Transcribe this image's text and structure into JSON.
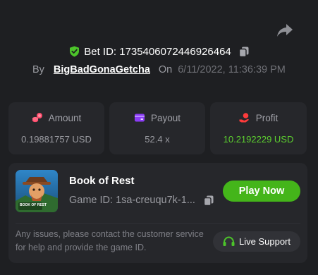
{
  "bet": {
    "id_label": "Bet ID:",
    "id_value": "1735406072446926464",
    "by_label": "By",
    "username": "BigBadGonaGetcha",
    "on_label": "On",
    "datetime": "6/11/2022, 11:36:39 PM"
  },
  "stats": [
    {
      "label": "Amount",
      "value": "0.19881757 USD",
      "icon": "coins-icon",
      "color": "#ff4d6d"
    },
    {
      "label": "Payout",
      "value": "52.4 x",
      "icon": "wallet-icon",
      "color": "#8b3cf5"
    },
    {
      "label": "Profit",
      "value": "10.2192229 USD",
      "icon": "profit-hand-icon",
      "color": "#ff3b3b"
    }
  ],
  "game": {
    "thumb_text": "BOOK OF REST",
    "title": "Book of Rest",
    "id_text": "Game ID: 1sa-creuqu7k-1...",
    "play_label": "Play Now",
    "issues_text": "Any issues, please contact the customer service for help and provide the game ID.",
    "support_label": "Live Support"
  },
  "colors": {
    "background": "#1e1f22",
    "card": "#26272b",
    "accent_green": "#44b51a",
    "profit_green": "#5dd12f"
  }
}
